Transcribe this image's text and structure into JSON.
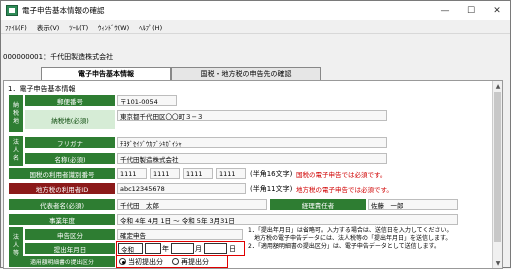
{
  "window": {
    "title": "電子申告基本情報の確認",
    "minimize": "—",
    "maximize": "☐",
    "close": "✕"
  },
  "menu": [
    "ﾌｧｲﾙ(F)",
    "表示(V)",
    "ﾂｰﾙ(T)",
    "ｳｨﾝﾄﾞｳ(W)",
    "ﾍﾙﾌﾟ(H)"
  ],
  "company_bar": "000000001：千代田製造株式会社",
  "tabs": [
    "電子申告基本情報",
    "国税・地方税の申告先の確認"
  ],
  "section_title": "1．電子申告基本情報",
  "side_labels": {
    "taxplace": "納\n税\n地",
    "corp": "法\n人\n名",
    "filing": "法\n人\n等"
  },
  "fields": {
    "postal_label": "郵便番号",
    "postal_value": "〒101-0054",
    "address_label": "納税地(必須)",
    "address_value": "東京都千代田区〇〇町３−３",
    "furigana_label": "フリガナ",
    "furigana_value": "ﾁﾖﾀﾞｾｲｿﾞｳｶﾌﾞｼｷｶﾞｲｼｬ",
    "name_label": "名称(必須)",
    "name_value": "千代田製造株式会社",
    "national_id_label": "国税の利用者識別番号",
    "national_id": [
      "1111",
      "1111",
      "1111",
      "1111"
    ],
    "national_id_hint": "(半角16文字)",
    "national_id_req": "国税の電子申告では必須です。",
    "local_id_label": "地方税の利用者ID",
    "local_id_value": "abc12345678",
    "local_id_hint": "(半角11文字)",
    "local_id_req": "地方税の電子申告では必須です。",
    "rep_label": "代表者名(必須)",
    "rep_value": "千代田　太郎",
    "acct_label": "経理責任者",
    "acct_value": "佐藤　一郎",
    "year_label": "事業年度",
    "year_value": "令和 4年 4月 1日 ～ 令和 5年 3月31日",
    "filing_type_label": "申告区分",
    "filing_type_value": "確定申告",
    "submit_date_label": "提出年月日",
    "era": "令和",
    "year_suffix": "年",
    "month_suffix": "月",
    "day_suffix": "日",
    "option_label": "適用額明細書の提出区分",
    "option_first": "当初提出分",
    "option_resubmit": "再提出分"
  },
  "notes": [
    "1．「提出年月日」は省略可。入力する場合は、送信日を入力してください。",
    "　地方税の電子申告データには、法人税等の「提出年月日」を送信します。",
    "2．「適用額明細書の提出区分」は、電子申告データとして送信します。"
  ]
}
